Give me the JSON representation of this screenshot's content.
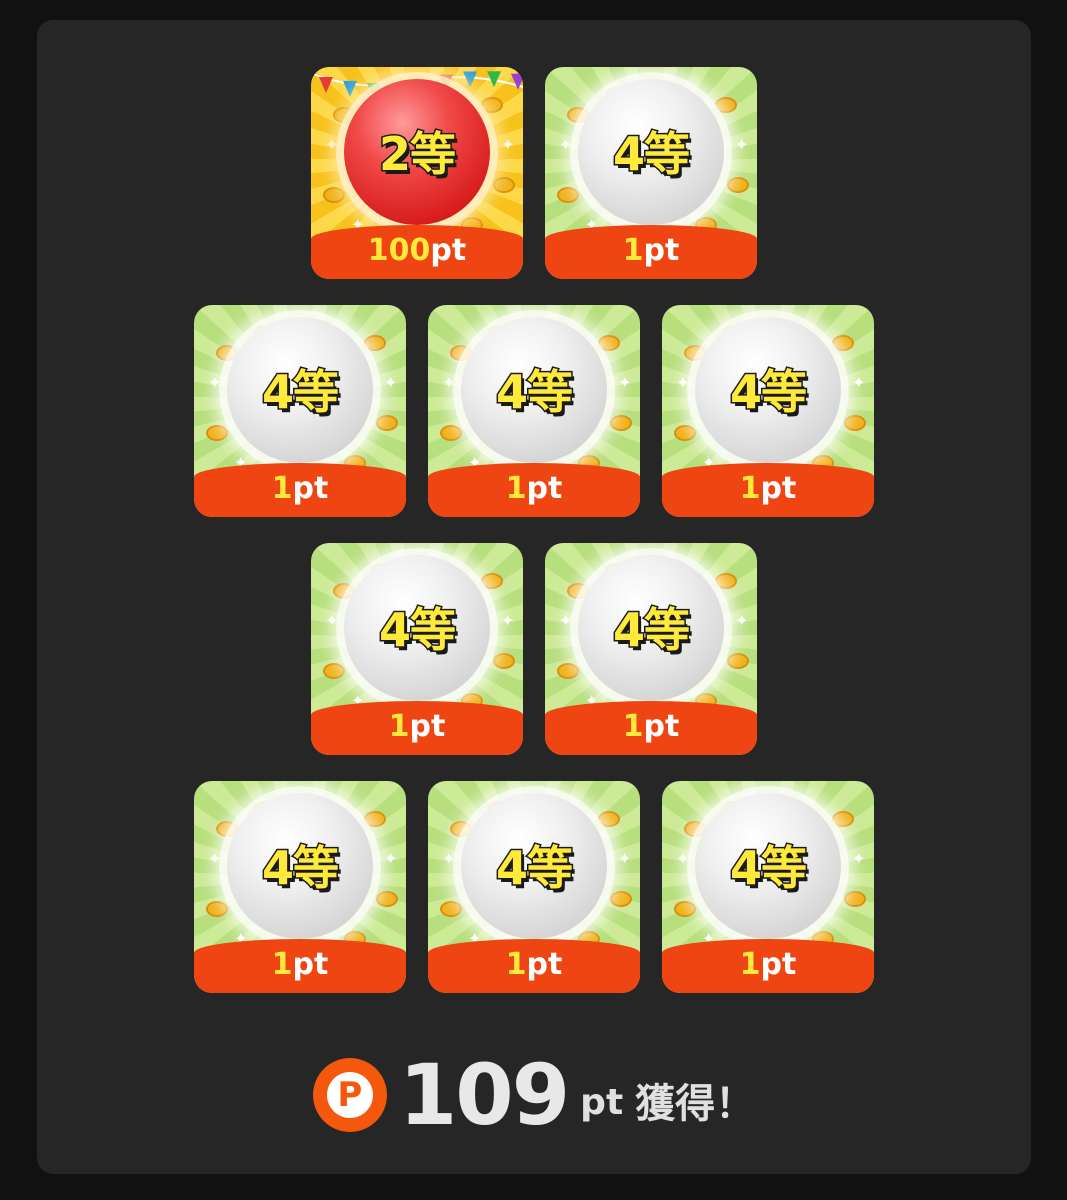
{
  "colors": {
    "panel": "#262626",
    "band": "#ee4512",
    "rank_text": "#ffe93a",
    "badge": "#f4580c"
  },
  "results": [
    [
      {
        "rank": "2等",
        "points": "100",
        "unit": "pt",
        "style": "gold"
      },
      {
        "rank": "4等",
        "points": "1",
        "unit": "pt",
        "style": "green"
      }
    ],
    [
      {
        "rank": "4等",
        "points": "1",
        "unit": "pt",
        "style": "green"
      },
      {
        "rank": "4等",
        "points": "1",
        "unit": "pt",
        "style": "green"
      },
      {
        "rank": "4等",
        "points": "1",
        "unit": "pt",
        "style": "green"
      }
    ],
    [
      {
        "rank": "4等",
        "points": "1",
        "unit": "pt",
        "style": "green"
      },
      {
        "rank": "4等",
        "points": "1",
        "unit": "pt",
        "style": "green"
      }
    ],
    [
      {
        "rank": "4等",
        "points": "1",
        "unit": "pt",
        "style": "green"
      },
      {
        "rank": "4等",
        "points": "1",
        "unit": "pt",
        "style": "green"
      },
      {
        "rank": "4等",
        "points": "1",
        "unit": "pt",
        "style": "green"
      }
    ]
  ],
  "total": {
    "badge_letter": "P",
    "value": "109",
    "unit": "pt",
    "label": "獲得！",
    "badge_icon": "point-coin-icon"
  }
}
